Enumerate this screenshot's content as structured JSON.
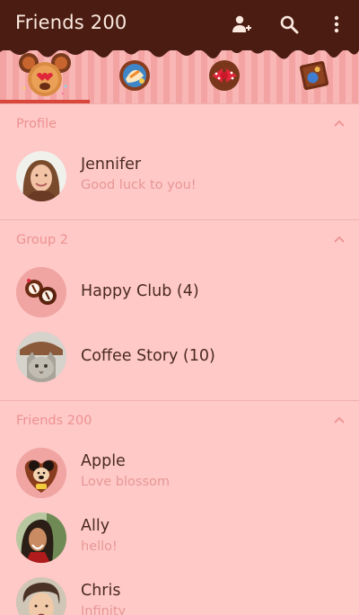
{
  "appbar": {
    "title": "Friends 200",
    "icons": [
      "add-friend-icon",
      "search-icon",
      "more-vert-icon"
    ]
  },
  "tabs": [
    {
      "name": "friends-tab",
      "icon": "mouse-cookie-icon",
      "selected": true
    },
    {
      "name": "chats-tab",
      "icon": "candy-cupcake-icon",
      "selected": false
    },
    {
      "name": "timeline-tab",
      "icon": "polka-bow-cookie-icon",
      "selected": false
    },
    {
      "name": "more-tab",
      "icon": "chocolate-box-icon",
      "selected": false
    }
  ],
  "colors": {
    "appbar": "#4a1c12",
    "background": "#ffc9c8",
    "accent": "#d9463b",
    "section_title": "#ec9290"
  },
  "sections": {
    "profile": {
      "title": "Profile",
      "rows": [
        {
          "name": "Jennifer",
          "status": "Good luck to you!"
        }
      ]
    },
    "group": {
      "title": "Group 2",
      "rows": [
        {
          "name": "Happy Club (4)"
        },
        {
          "name": "Coffee Story (10)"
        }
      ]
    },
    "friends": {
      "title": "Friends 200",
      "rows": [
        {
          "name": "Apple",
          "status": "Love blossom"
        },
        {
          "name": "Ally",
          "status": "hello!"
        },
        {
          "name": "Chris",
          "status": "Infinity"
        }
      ]
    }
  }
}
